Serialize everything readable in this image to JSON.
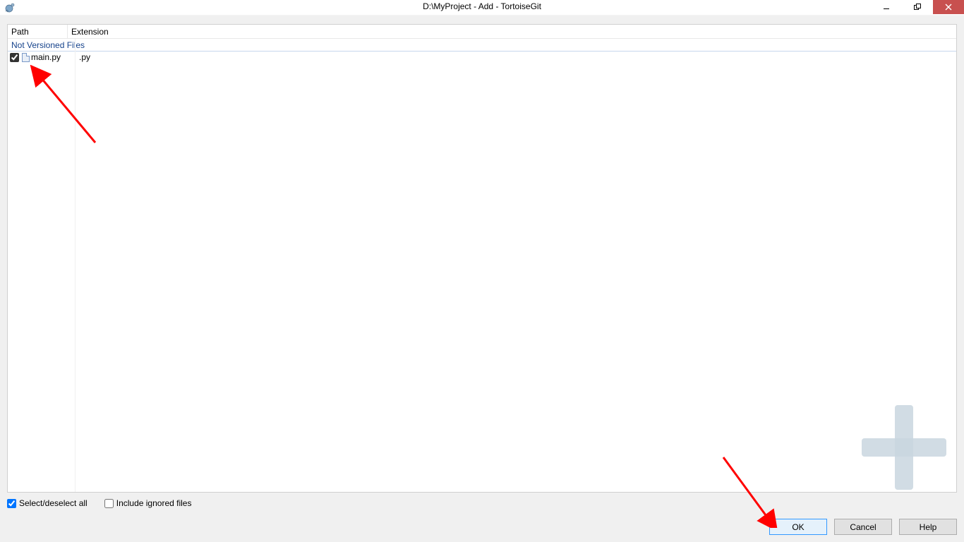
{
  "titlebar": {
    "title": "D:\\MyProject - Add - TortoiseGit"
  },
  "columns": {
    "path": "Path",
    "extension": "Extension"
  },
  "groups": {
    "not_versioned": "Not Versioned Files"
  },
  "files": [
    {
      "checked": true,
      "name": "main.py",
      "ext": ".py"
    }
  ],
  "options": {
    "select_all_label": "Select/deselect all",
    "select_all_checked": true,
    "include_ignored_label": "Include ignored files",
    "include_ignored_checked": false
  },
  "buttons": {
    "ok": "OK",
    "cancel": "Cancel",
    "help": "Help"
  }
}
